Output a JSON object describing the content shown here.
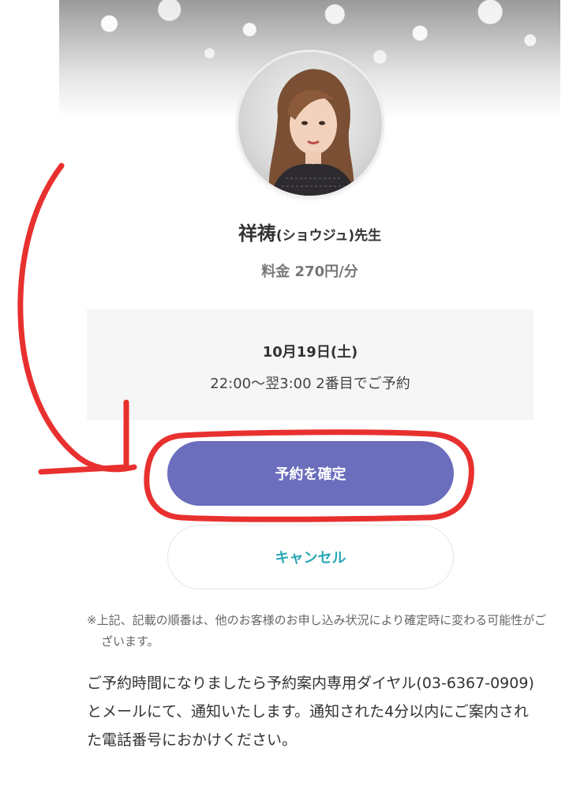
{
  "fortune_teller": {
    "name": "祥祷",
    "reading": "(ショウジュ)",
    "suffix": "先生",
    "price": "料金 270円/分"
  },
  "reservation": {
    "date": "10月19日(土)",
    "slot": "22:00〜翌3:00 2番目でご予約"
  },
  "buttons": {
    "confirm_label": "予約を確定",
    "cancel_label": "キャンセル"
  },
  "notice": "※上記、記載の順番は、他のお客様のお申し込み状況により確定時に変わる可能性がございます。",
  "body_text": "ご予約時間になりましたら予約案内専用ダイヤル(03-6367-0909)とメールにて、通知いたします。通知された4分以内にご案内された電話番号におかけください。",
  "colors": {
    "confirm_button": "#6b6dbd",
    "cancel_text": "#2aa7b5",
    "annotation_red": "#e8302f",
    "info_box_bg": "#f6f6f6"
  },
  "icons": [
    "avatar-portrait",
    "annotation-arrow",
    "annotation-highlight-outline"
  ]
}
